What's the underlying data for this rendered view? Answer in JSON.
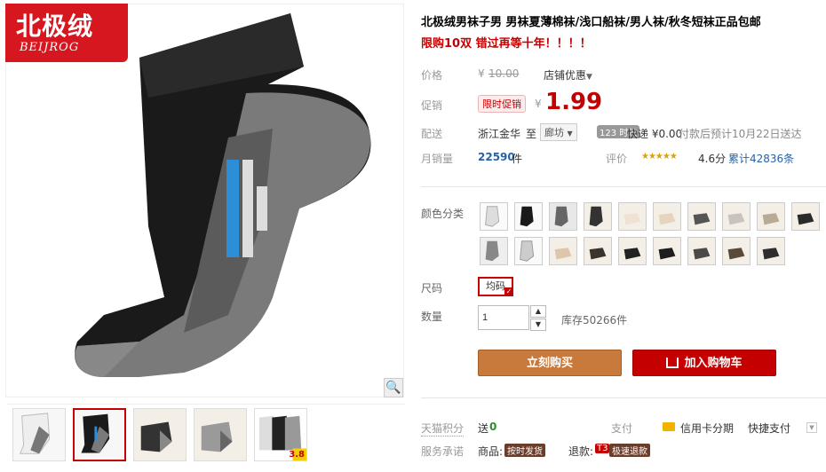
{
  "brand": {
    "name_cn": "北极绒",
    "name_en": "BEIJROG",
    "color": "#d7171f"
  },
  "product": {
    "title": "北极绒男袜子男 男袜夏薄棉袜/浅口船袜/男人袜/秋冬短袜正品包邮",
    "subtitle": "限购10双 错过再等十年！！！！"
  },
  "price": {
    "label": "价格",
    "currency": "¥",
    "original": "10.00",
    "store_discount": "店铺优惠",
    "promo_label": "促销",
    "promo_badge": "限时促销",
    "promo_currency": "¥",
    "promo_value": "1.99",
    "accent": "#c40000"
  },
  "shipping": {
    "label": "配送",
    "from": "浙江金华",
    "to_word": "至",
    "dest": "廊坊",
    "hours_badge": "123 时效",
    "method": "快递 ¥0.00",
    "eta": "付款后预计10月22日送达"
  },
  "sales": {
    "label": "月销量",
    "count": "22590",
    "unit": "件",
    "rating_label": "评价",
    "stars": "★★★★★",
    "score": "4.6分",
    "total_reviews": "累计42836条"
  },
  "colors": {
    "label": "颜色分类"
  },
  "size": {
    "label": "尺码",
    "selected": "均码"
  },
  "quantity": {
    "label": "数量",
    "value": "1",
    "stock": "库存50266件"
  },
  "actions": {
    "buy_now": "立刻购买",
    "add_cart": "加入购物车",
    "buy_color": "#c77a3c"
  },
  "footer": {
    "points_label": "天猫积分",
    "points_text": "送",
    "points_value": "0",
    "pay_label": "支付",
    "card_pay": "信用卡分期",
    "quick_pay": "快捷支付",
    "service_label": "服务承诺",
    "goods_label": "商品:",
    "goods_tag": "按时发货",
    "refund_label": "退款:",
    "refund_t3": "T3",
    "refund_tag": "极速退款"
  },
  "thumb_badge": "3.8",
  "icons": {
    "zoom": "magnifier-icon",
    "cart": "cart-icon",
    "card": "credit-card-icon"
  }
}
